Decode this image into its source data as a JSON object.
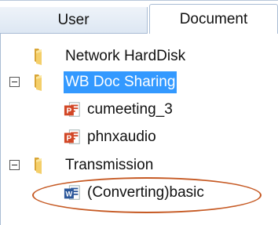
{
  "tabs": {
    "user_label": "User",
    "document_label": "Document"
  },
  "tree": {
    "nodes": [
      {
        "label": "Network HardDisk",
        "icon": "folder-icon"
      },
      {
        "label": "WB Doc Sharing",
        "icon": "folder-icon",
        "selected": true,
        "expanded": true
      },
      {
        "label": "cumeeting_3",
        "icon": "powerpoint-icon"
      },
      {
        "label": "phnxaudio",
        "icon": "powerpoint-icon"
      },
      {
        "label": "Transmission",
        "icon": "folder-icon",
        "expanded": true
      },
      {
        "label": "(Converting)basic",
        "icon": "word-icon",
        "highlighted": true
      }
    ]
  },
  "colors": {
    "selection": "#3399ff",
    "highlight_oval": "#c65a24",
    "folder": "#f0c75e",
    "powerpoint": "#d24726",
    "word": "#2b579a"
  }
}
